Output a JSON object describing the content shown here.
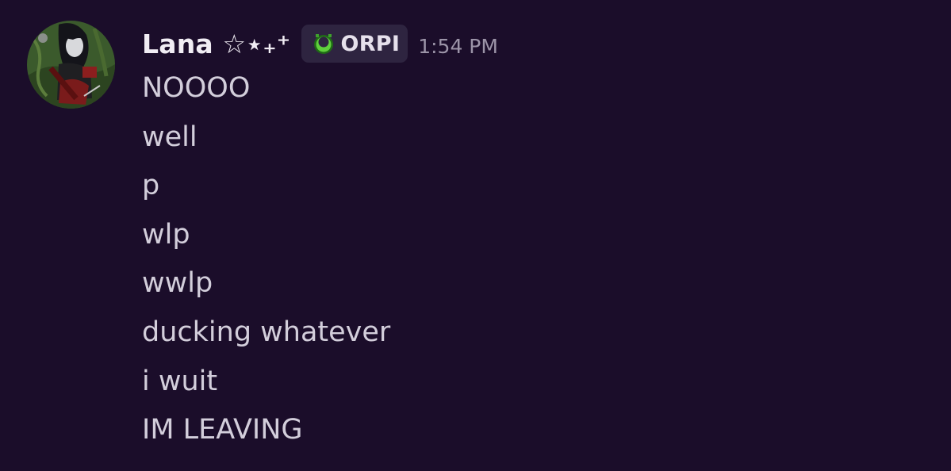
{
  "message": {
    "author": {
      "username": "Lana ☆⋆₊⁺",
      "tag": "ORPI",
      "tag_icon": "green-ring-icon",
      "avatar": "pixel-art-avatar"
    },
    "timestamp": "1:54 PM",
    "lines": [
      "NOOOO",
      "well",
      "p",
      "wlp",
      "wwlp",
      "ducking whatever",
      "i wuit",
      "IM LEAVING"
    ]
  },
  "colors": {
    "background": "#1b0d2a",
    "username": "#f1edf4",
    "message_text": "#d3cedb",
    "timestamp": "#9c94a8",
    "tag_background": "#2e2440",
    "tag_icon_green": "#5fd03c"
  }
}
